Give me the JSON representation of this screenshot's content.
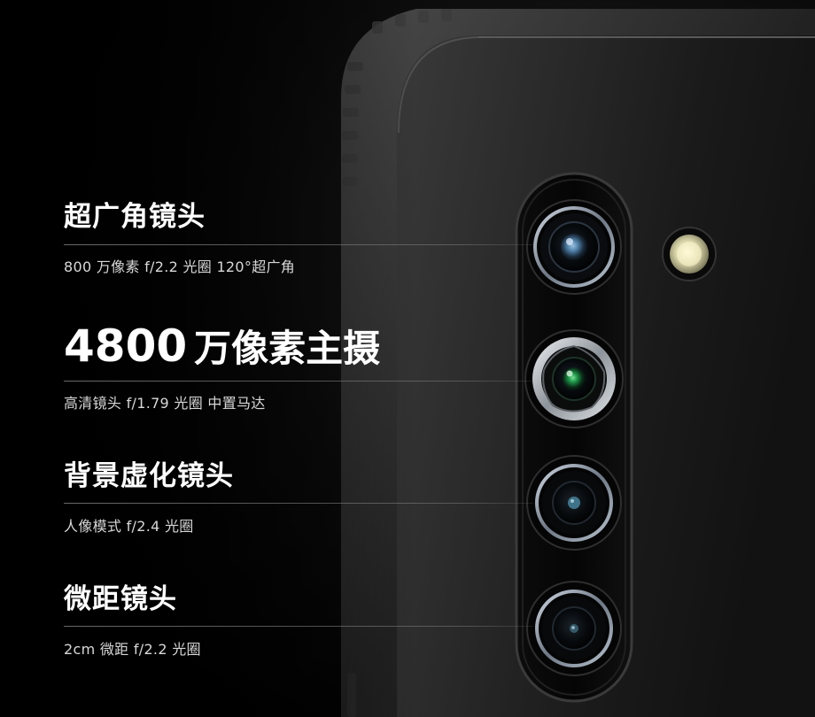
{
  "specs": [
    {
      "title": "超广角镜头",
      "subtitle": "800 万像素  f/2.2 光圈  120°超广角"
    },
    {
      "title_number": "4800",
      "title": "万像素主摄",
      "subtitle": "高清镜头  f/1.79 光圈  中置马达"
    },
    {
      "title": "背景虚化镜头",
      "subtitle": "人像模式  f/2.4 光圈"
    },
    {
      "title": "微距镜头",
      "subtitle": "2cm 微距  f/2.2 光圈"
    }
  ],
  "colors": {
    "background": "#000000",
    "phone_body": "#2b2b2b",
    "lens_ring": "#9aa6b5",
    "main_lens_ring": "#c9ced4",
    "main_lens_glass": "#1f9a4a",
    "ultrawide_lens_glass": "#5f8fb5",
    "flash": "#f2efc8"
  }
}
